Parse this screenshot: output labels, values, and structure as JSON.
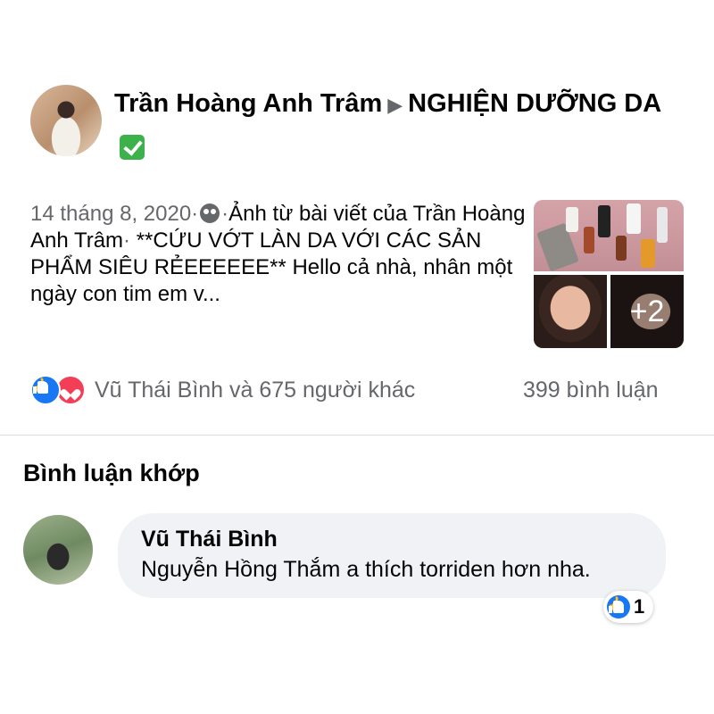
{
  "post": {
    "author": "Trần Hoàng Anh Trâm",
    "arrow": "▶",
    "group": "NGHIỆN DƯỠNG DA",
    "date": "14 tháng 8, 2020",
    "sep": "·",
    "audience_icon": "friends-icon",
    "shared_from": "Ảnh từ bài viết của",
    "shared_author": "Trần Hoàng Anh Trâm",
    "title": "**CỨU VỚT LÀN DA VỚI CÁC SẢN PHẨM SIÊU RẺEEEEEE**",
    "excerpt": "Hello cả nhà, nhân một ngày con tim em v...",
    "photo_more": "+2",
    "reactions_text": "Vũ Thái Bình và 675 người khác",
    "comments_count": "399 bình luận"
  },
  "comments_section": {
    "title": "Bình luận khớp",
    "comment": {
      "author": "Vũ Thái Bình",
      "text": "Nguyễn Hồng Thắm  a thích torriden hơn nha.",
      "reaction_count": "1"
    }
  },
  "colors": {
    "like_blue": "#1877f2",
    "love_red": "#f33e58",
    "muted": "#65676b",
    "bubble": "#f0f2f5"
  }
}
